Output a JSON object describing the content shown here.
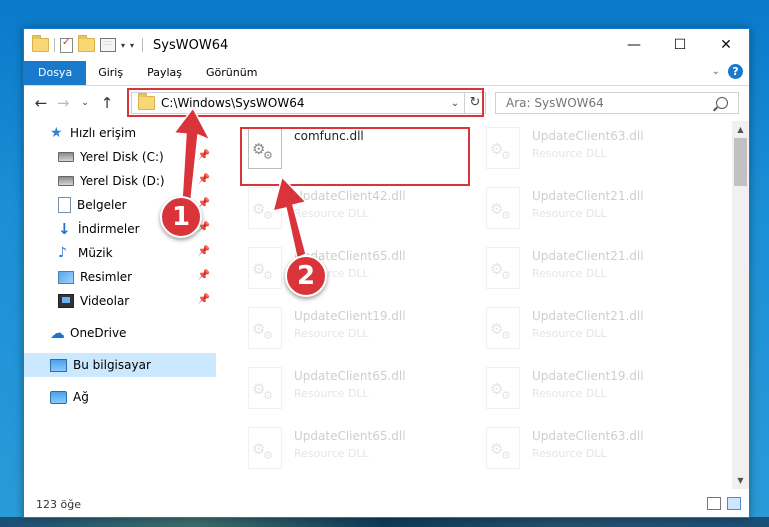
{
  "window": {
    "title": "SysWOW64",
    "controls": {
      "minimize": "—",
      "maximize": "☐",
      "close": "✕"
    }
  },
  "ribbon": {
    "tabs": [
      "Dosya",
      "Giriş",
      "Paylaş",
      "Görünüm"
    ],
    "help": "?"
  },
  "address": {
    "path": "C:\\Windows\\SysWOW64",
    "search_placeholder": "Ara: SysWOW64"
  },
  "sidebar": {
    "items": [
      {
        "label": "Hızlı erişim",
        "icon": "star-icon",
        "pinned": false
      },
      {
        "label": "Yerel Disk (C:)",
        "icon": "disk-icon",
        "pinned": true
      },
      {
        "label": "Yerel Disk (D:)",
        "icon": "disk-icon",
        "pinned": true
      },
      {
        "label": "Belgeler",
        "icon": "documents-icon",
        "pinned": true
      },
      {
        "label": "İndirmeler",
        "icon": "download-icon",
        "pinned": true
      },
      {
        "label": "Müzik",
        "icon": "music-icon",
        "pinned": true
      },
      {
        "label": "Resimler",
        "icon": "pictures-icon",
        "pinned": true
      },
      {
        "label": "Videolar",
        "icon": "videos-icon",
        "pinned": true
      },
      {
        "label": "OneDrive",
        "icon": "cloud-icon",
        "pinned": false
      },
      {
        "label": "Bu bilgisayar",
        "icon": "computer-icon",
        "pinned": false,
        "selected": true
      },
      {
        "label": "Ağ",
        "icon": "network-icon",
        "pinned": false
      }
    ]
  },
  "files": [
    {
      "name": "comfunc.dll",
      "type": "",
      "faded": false
    },
    {
      "name": "UpdateClient63.dll",
      "type": "Resource DLL",
      "faded": true
    },
    {
      "name": "UpdateClient42.dll",
      "type": "Resource DLL",
      "faded": true
    },
    {
      "name": "UpdateClient21.dll",
      "type": "Resource DLL",
      "faded": true
    },
    {
      "name": "UpdateClient65.dll",
      "type": "Resource DLL",
      "faded": true
    },
    {
      "name": "UpdateClient21.dll",
      "type": "Resource DLL",
      "faded": true
    },
    {
      "name": "UpdateClient19.dll",
      "type": "Resource DLL",
      "faded": true
    },
    {
      "name": "UpdateClient21.dll",
      "type": "Resource DLL",
      "faded": true
    },
    {
      "name": "UpdateClient65.dll",
      "type": "Resource DLL",
      "faded": true
    },
    {
      "name": "UpdateClient19.dll",
      "type": "Resource DLL",
      "faded": true
    },
    {
      "name": "UpdateClient65.dll",
      "type": "Resource DLL",
      "faded": true
    },
    {
      "name": "UpdateClient63.dll",
      "type": "Resource DLL",
      "faded": true
    }
  ],
  "status": {
    "item_count": "123 öğe"
  },
  "annotations": {
    "badge1": "1",
    "badge2": "2",
    "color": "#d9343a"
  }
}
